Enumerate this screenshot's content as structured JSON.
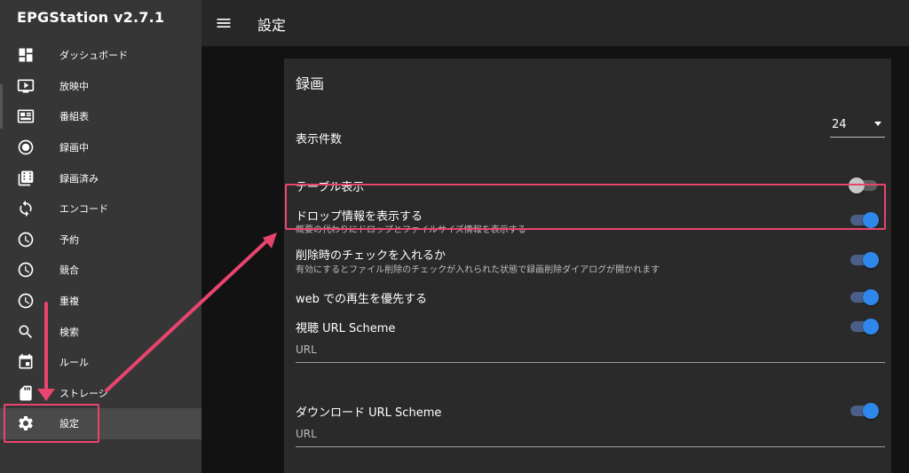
{
  "app": {
    "title": "EPGStation v2.7.1"
  },
  "header": {
    "title": "設定",
    "menu_icon": "menu-icon"
  },
  "sidebar": {
    "items": [
      {
        "label": "ダッシュボード",
        "icon": "dashboard-icon"
      },
      {
        "label": "放映中",
        "icon": "live-tv-icon"
      },
      {
        "label": "番組表",
        "icon": "program-guide-icon"
      },
      {
        "label": "録画中",
        "icon": "recording-icon"
      },
      {
        "label": "録画済み",
        "icon": "recorded-icon"
      },
      {
        "label": "エンコード",
        "icon": "encode-icon"
      },
      {
        "label": "予約",
        "icon": "clock-icon"
      },
      {
        "label": "競合",
        "icon": "clock-icon"
      },
      {
        "label": "重複",
        "icon": "clock-icon"
      },
      {
        "label": "検索",
        "icon": "search-icon"
      },
      {
        "label": "ルール",
        "icon": "calendar-icon"
      },
      {
        "label": "ストレージ",
        "icon": "sd-card-icon"
      },
      {
        "label": "設定",
        "icon": "gear-icon",
        "active": true
      }
    ]
  },
  "settings": {
    "section_title": "録画",
    "page_size": {
      "label": "表示件数",
      "value": "24"
    },
    "table_view": {
      "label": "テーブル表示",
      "enabled": false
    },
    "show_drop": {
      "label": "ドロップ情報を表示する",
      "sub": "概要の代わりにドロップとファイルサイズ情報を表示する",
      "enabled": true
    },
    "delete_check": {
      "label": "削除時のチェックを入れるか",
      "sub": "有効にするとファイル削除のチェックが入れられた状態で録画削除ダイアログが開かれます",
      "enabled": true
    },
    "web_playback": {
      "label": "web での再生を優先する",
      "enabled": true
    },
    "view_url": {
      "label": "視聴 URL Scheme",
      "enabled": true,
      "placeholder": "URL"
    },
    "download_url": {
      "label": "ダウンロード URL Scheme",
      "enabled": true,
      "placeholder": "URL"
    }
  },
  "colors": {
    "accent": "#2f86eb",
    "highlight": "#e8446e"
  }
}
